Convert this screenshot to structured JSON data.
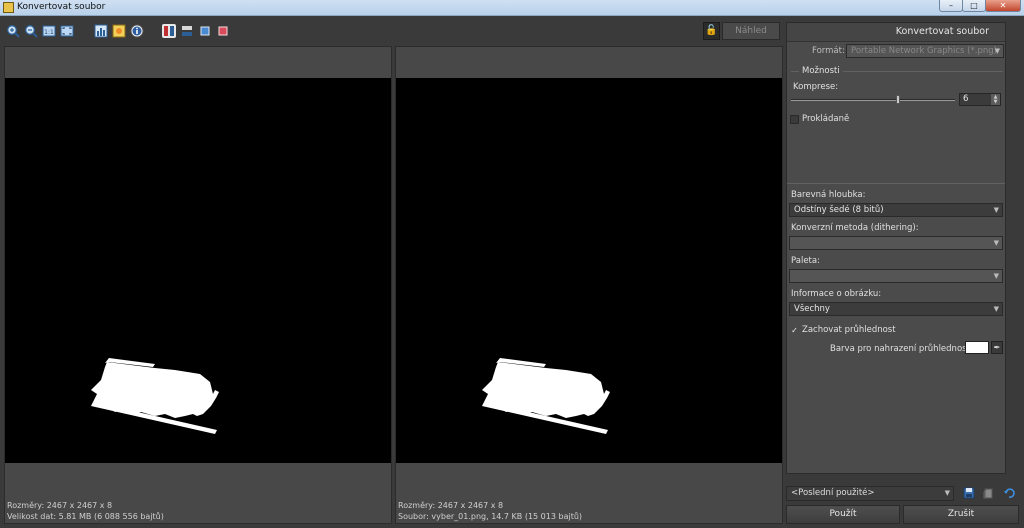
{
  "window": {
    "title": "Konvertovat soubor",
    "controls": {
      "minimize": "–",
      "maximize": "□",
      "close": "✕"
    }
  },
  "toolbar": {
    "icons": [
      "zoom-in-icon",
      "zoom-out-icon",
      "actual-size-icon",
      "fit-icon",
      "histogram-icon",
      "color-icon",
      "info-icon",
      "split-vertical-icon",
      "split-horizontal-icon",
      "single-view-icon",
      "original-view-icon"
    ],
    "lock_glyph": "🔓",
    "preview_label": "Náhled"
  },
  "panes": {
    "left": {
      "dimensions": "Rozměry: 2467 x 2467 x 8",
      "size": "Velikost dat: 5.81 MB (6 088 556 bajtů)"
    },
    "right": {
      "dimensions": "Rozměry: 2467 x 2467 x 8",
      "file": "Soubor: vyber_01.png, 14.7 KB (15 013 bajtů)"
    }
  },
  "panel": {
    "title": "Konvertovat soubor",
    "format_label": "Formát:",
    "format_value": "Portable Network Graphics (*.png)",
    "options_group": "Možnosti",
    "compression_label": "Komprese:",
    "compression_value": "6",
    "compression_level": 6,
    "compression_max": 9,
    "interlaced_label": "Prokládaně",
    "interlaced_checked": false,
    "color_depth_label": "Barevná hloubka:",
    "color_depth_value": "Odstíny šedé (8 bitů)",
    "dithering_label": "Konverzní metoda (dithering):",
    "dithering_value": "",
    "palette_label": "Paleta:",
    "palette_value": "",
    "image_info_label": "Informace o obrázku:",
    "image_info_value": "Všechny",
    "keep_transparency_label": "Zachovat průhlednost",
    "keep_transparency_checked": true,
    "replace_color_label": "Barva pro nahrazení průhlednosti:",
    "replace_color": "#ffffff"
  },
  "footer": {
    "recent_value": "<Poslední použité>",
    "apply_label": "Použít",
    "cancel_label": "Zrušit"
  },
  "colors": {
    "background": "#3a3a3a",
    "panel": "#4b4b4b",
    "canvas": "#000000",
    "titlebar": "#c4d8ee"
  }
}
